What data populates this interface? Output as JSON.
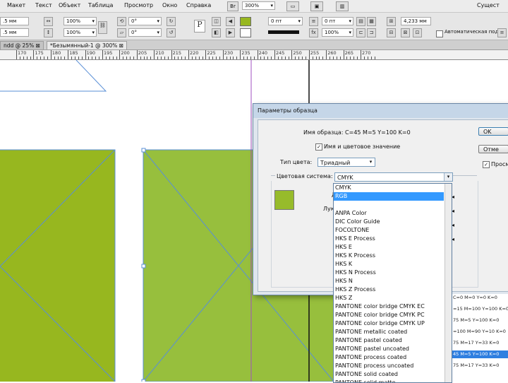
{
  "menu": {
    "items": [
      "Макет",
      "Текст",
      "Объект",
      "Таблица",
      "Просмотр",
      "Окно",
      "Справка"
    ],
    "bridge": "Br",
    "zoom": "300%",
    "right_label": "Сущест"
  },
  "control": {
    "x": ".5 мм",
    "y": ".5 мм",
    "scale_x": "100%",
    "scale_y": "100%",
    "rotate": "0°",
    "shear": "0°",
    "stroke_weight": "0 пт",
    "stroke_weight_2": "0 пт",
    "opacity": "100%",
    "gap": "4,233 мм",
    "autofit": "Автоматическая подг"
  },
  "tabs": {
    "tab1": "ndd @ 25%",
    "tab2": "*Безымянный-1 @ 300%"
  },
  "ruler": {
    "labels": [
      "170",
      "175",
      "180",
      "185",
      "190",
      "195",
      "200",
      "205",
      "210",
      "215",
      "220",
      "225",
      "230",
      "235",
      "240",
      "245",
      "250",
      "255",
      "260",
      "265",
      "270"
    ]
  },
  "dialog": {
    "title": "Параметры образца",
    "swatch_name_label": "Имя образца: C=45 M=5 Y=100 K=0",
    "name_with_value_label": "Имя и цветовое значение",
    "name_with_value_checked": true,
    "color_type_label": "Тип цвета:",
    "color_type_value": "Триадный",
    "color_mode_label": "Цветовая система:",
    "color_mode_value": "CMYK",
    "ok_label": "OK",
    "cancel_label": "Отме",
    "preview_label": "Просм",
    "preview_checked": true,
    "partial_label_d": "Д",
    "partial_label_l": "Лук",
    "swatch_color": "#97bb2b"
  },
  "color_list": {
    "items": [
      "CMYK",
      "RGB",
      "",
      "ANPA Color",
      "DIC Color Guide",
      "FOCOLTONE",
      "HKS E Process",
      "HKS E",
      "HKS K Process",
      "HKS K",
      "HKS N Process",
      "HKS N",
      "HKS Z Process",
      "HKS Z",
      "PANTONE color bridge CMYK EC",
      "PANTONE color bridge CMYK PC",
      "PANTONE color bridge CMYK UP",
      "PANTONE metallic coated",
      "PANTONE pastel coated",
      "PANTONE pastel uncoated",
      "PANTONE process coated",
      "PANTONE process uncoated",
      "PANTONE solid coated",
      "PANTONE solid matte"
    ],
    "selected_index": 1,
    "highlight_color": "#3399ff"
  },
  "swatches": {
    "items": [
      "C=0 M=0 Y=0 K=0",
      "=15 M=100 Y=100 K=0",
      "75 M=5 Y=100 K=0",
      "=100 M=90 Y=10 K=0",
      "75 M=17 Y=33 K=0",
      "45 M=5 Y=100 K=0",
      "75 M=17 Y=33 K=0"
    ],
    "selected_index": 5
  },
  "colors": {
    "green_fill": "#97b71f",
    "green_light": "#97bf3d",
    "guide_blue": "#5a8fd6"
  }
}
